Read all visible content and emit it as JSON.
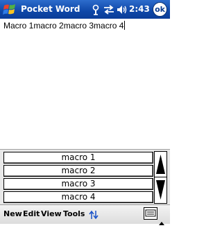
{
  "titlebar": {
    "app_title": "Pocket Word",
    "time": "2:43",
    "ok_label": "ok",
    "icons": [
      "windows-start-icon",
      "antenna-icon",
      "sync-icon",
      "speaker-icon"
    ]
  },
  "document": {
    "text": "Macro 1macro 2macro 3macro 4"
  },
  "macros": {
    "buttons": [
      "macro 1",
      "macro 2",
      "macro 3",
      "macro 4"
    ]
  },
  "menubar": {
    "items": [
      "New",
      "Edit",
      "View",
      "Tools"
    ],
    "icons": [
      "up-down-arrows-icon",
      "keyboard-icon",
      "chevron-up-icon"
    ]
  },
  "colors": {
    "titlebar": "#0e47a8",
    "panel": "#e8e8e8",
    "menubar": "#dcdcdc"
  }
}
